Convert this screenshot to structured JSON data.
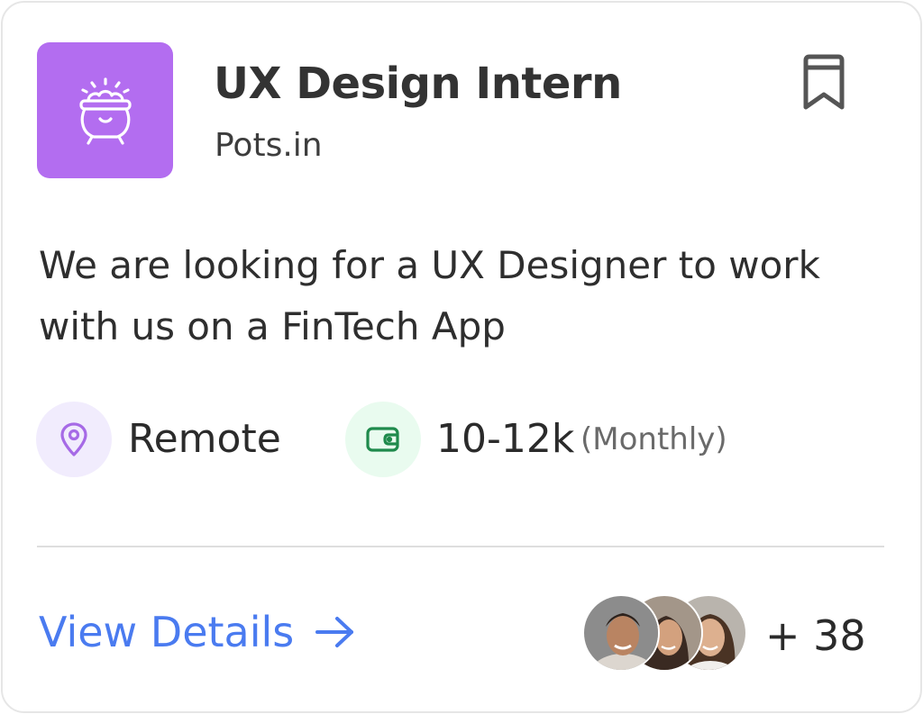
{
  "job": {
    "title": "UX Design Intern",
    "company": "Pots.in",
    "description": "We are looking for a UX Designer to work with us on a FinTech App",
    "logo_icon": "pot-icon",
    "bookmark_icon": "bookmark-icon"
  },
  "location": {
    "icon": "location-pin-icon",
    "label": "Remote"
  },
  "salary": {
    "icon": "wallet-icon",
    "amount": "10-12k",
    "period": "(Monthly)"
  },
  "footer": {
    "view_details_label": "View Details",
    "arrow_icon": "arrow-right-icon",
    "applicants_count": "+ 38"
  },
  "colors": {
    "logo_bg": "#b36df0",
    "location_chip_bg": "#f1ecfd",
    "location_icon": "#a66ae6",
    "salary_chip_bg": "#e9fbef",
    "salary_icon": "#1f8a4c",
    "link": "#4a7bf0",
    "bookmark": "#555555"
  }
}
